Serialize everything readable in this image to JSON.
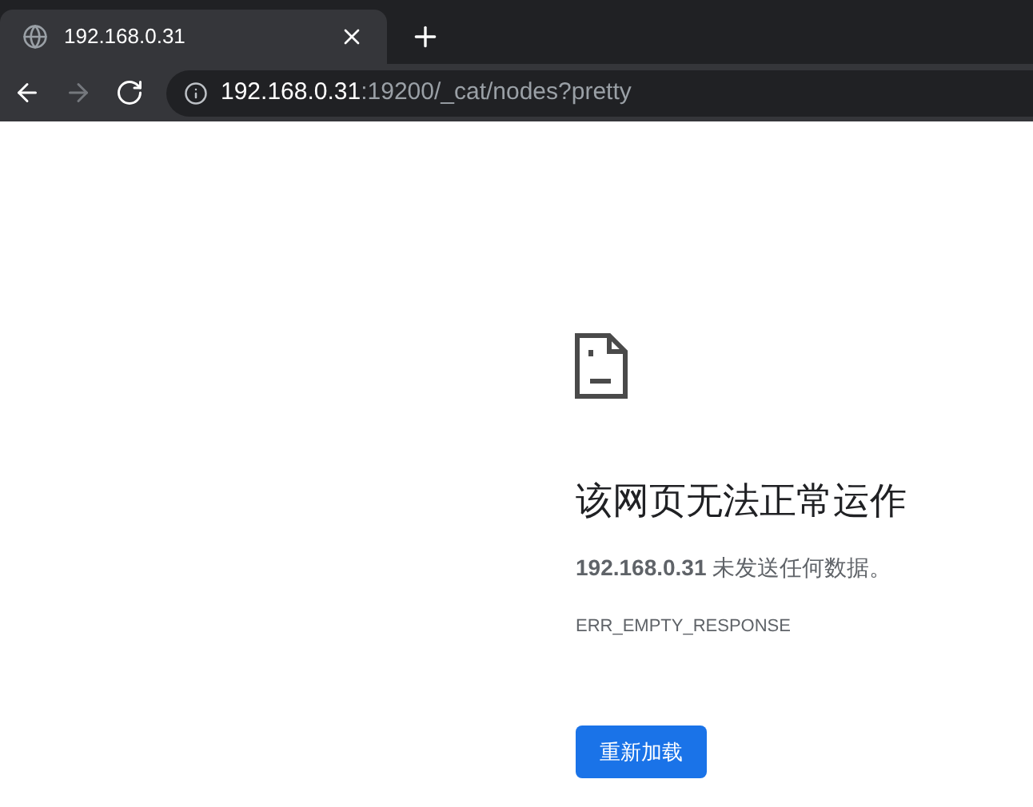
{
  "tabs": [
    {
      "title": "192.168.0.31",
      "selected": true
    }
  ],
  "toolbar": {
    "nav": [
      {
        "kind": "back",
        "disabled": false
      },
      {
        "kind": "forward",
        "disabled": true
      },
      {
        "kind": "reload",
        "disabled": false
      }
    ],
    "url_host": "192.168.0.31",
    "url_rest": ":19200/_cat/nodes?pretty"
  },
  "error": {
    "heading": "该网页无法正常运作",
    "message": "**192.168.0.31** 未发送任何数据。",
    "code": "ERR_EMPTY_RESPONSE",
    "button": "重新加载"
  }
}
